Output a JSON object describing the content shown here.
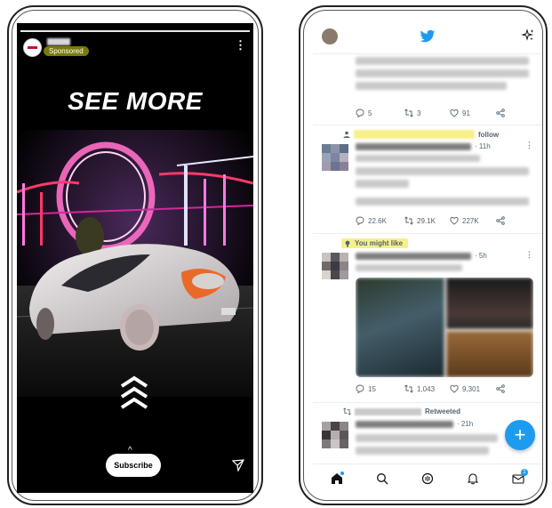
{
  "story": {
    "sponsored_label": "Sponsored",
    "headline": "SEE MORE",
    "cta_label": "Subscribe",
    "swipe_up_glyph": "^"
  },
  "twitter": {
    "tweets": [
      {
        "replies": "5",
        "retweets": "3",
        "likes": "91"
      },
      {
        "context_suffix": "follow",
        "time": "· 11h",
        "replies": "22.6K",
        "retweets": "29.1K",
        "likes": "227K"
      },
      {
        "context": "You might like",
        "time": "· 5h",
        "replies": "15",
        "retweets": "1,043",
        "likes": "9,301"
      },
      {
        "context_suffix": "Retweeted",
        "time": "· 21h"
      }
    ],
    "compose_glyph": "+",
    "messages_badge": "1"
  },
  "colors": {
    "twitter_blue": "#1d9bf0",
    "highlight": "#f7f08a",
    "sponsored_bg": "#7a7a0a"
  }
}
